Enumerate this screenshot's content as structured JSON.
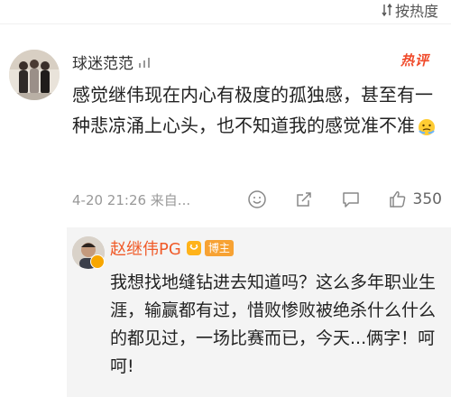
{
  "header": {
    "sort_label": "按热度"
  },
  "comment": {
    "username": "球迷范范",
    "hot_badge": "热评",
    "text": "感觉继伟现在内心有极度的孤独感，甚至有一种悲凉涌上心头，也不知道我的感觉准不准",
    "time": "4-20 21:26 来自...",
    "like_count": "350",
    "reply": {
      "username": "赵继伟PG",
      "tag": "博主",
      "text": "我想找地缝钻进去知道吗？这么多年职业生涯，输赢都有过，惜败惨败被绝杀什么什么的都见过，一场比赛而已，今天...俩字！呵呵!"
    }
  },
  "colors": {
    "hot": "#f04a2a",
    "reply_name": "#f05a28",
    "tag_bg": "#f7a233",
    "reply_bg": "#f4f4f4"
  },
  "icons": [
    "sort-icon",
    "level-icon",
    "emoji-icon",
    "emoji-reaction-icon",
    "share-icon",
    "comment-icon",
    "like-icon",
    "vip-icon",
    "verified-icon"
  ]
}
